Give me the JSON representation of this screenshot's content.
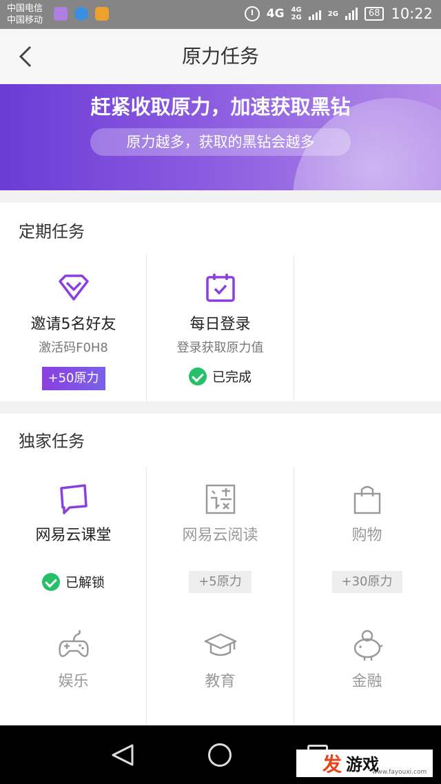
{
  "status_bar": {
    "carrier1": "中国电信",
    "carrier2": "中国移动",
    "net_4g": "4G",
    "net_4g_small_top": "4G",
    "net_4g_small_bottom": "2G",
    "net_2g": "2G",
    "battery": "68",
    "time": "10:22"
  },
  "header": {
    "title": "原力任务"
  },
  "banner": {
    "title": "赶紧收取原力，加速获取黑钻",
    "subtitle": "原力越多，获取的黑钻会越多"
  },
  "regular": {
    "title": "定期任务",
    "invite": {
      "name": "邀请5名好友",
      "sub": "激活码F0H8",
      "reward": "+50原力",
      "icon": "diamond-icon"
    },
    "login": {
      "name": "每日登录",
      "sub": "登录获取原力值",
      "status": "已完成",
      "icon": "calendar-check-icon"
    }
  },
  "exclusive": {
    "title": "独家任务",
    "items": [
      {
        "name": "网易云课堂",
        "status": "已解锁",
        "icon": "chat-bubble-icon"
      },
      {
        "name": "网易云阅读",
        "reward": "+5原力",
        "icon": "read-icon"
      },
      {
        "name": "购物",
        "reward": "+30原力",
        "icon": "shopping-bag-icon"
      },
      {
        "name": "娱乐",
        "icon": "gamepad-icon"
      },
      {
        "name": "教育",
        "icon": "graduation-cap-icon"
      },
      {
        "name": "金融",
        "icon": "piggy-bank-icon"
      }
    ]
  },
  "watermark": {
    "fa": "发",
    "main": "游戏",
    "url": "www.fayouxi.com"
  },
  "colors": {
    "accent": "#8a3fe0",
    "success": "#27c06a"
  }
}
